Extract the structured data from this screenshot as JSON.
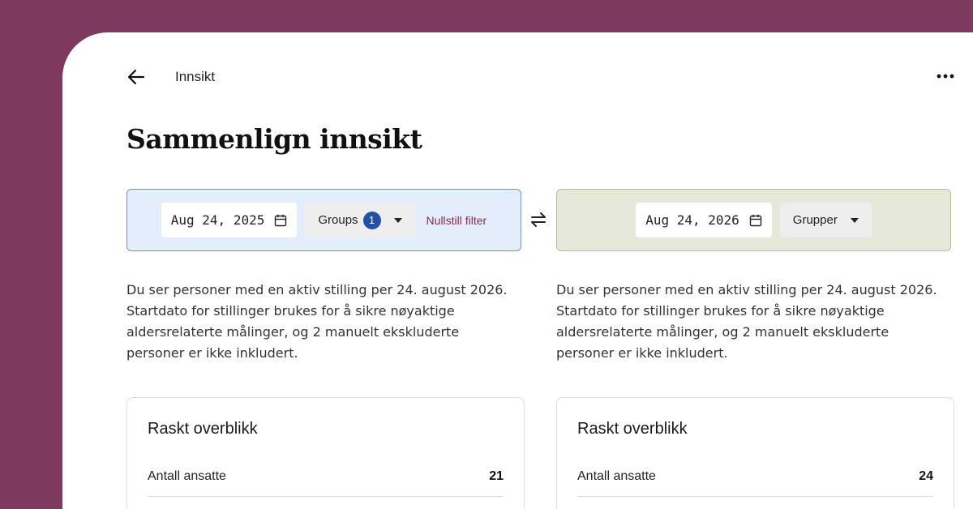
{
  "header": {
    "title": "Innsikt",
    "back_icon": "arrow-left-icon",
    "more_icon": "more-horizontal-icon"
  },
  "page": {
    "title": "Sammenlign innsikt"
  },
  "left": {
    "date": "Aug 24, 2025",
    "group_label": "Groups",
    "group_count": "1",
    "reset_label": "Nullstill filter",
    "description": "Du ser personer med en aktiv stilling per 24. august 2026. Startdato for stillinger brukes for å sikre nøyaktige aldersrelaterte målinger, og 2 manuelt ekskluderte personer er ikke inkludert.",
    "card": {
      "title": "Raskt overblikk",
      "rows": [
        {
          "label": "Antall ansatte",
          "value": "21"
        }
      ]
    }
  },
  "right": {
    "date": "Aug 24, 2026",
    "group_label": "Grupper",
    "description": "Du ser personer med en aktiv stilling per 24. august 2026. Startdato for stillinger brukes for å sikre nøyaktige aldersrelaterte målinger, og 2 manuelt ekskluderte personer er ikke inkludert.",
    "card": {
      "title": "Raskt overblikk",
      "rows": [
        {
          "label": "Antall ansatte",
          "value": "24"
        }
      ]
    }
  },
  "colors": {
    "background": "#7d3a5e",
    "left_panel": "#e3edfb",
    "right_panel": "#e6e9da",
    "badge": "#2450a8",
    "reset_link": "#8a2a4b"
  }
}
